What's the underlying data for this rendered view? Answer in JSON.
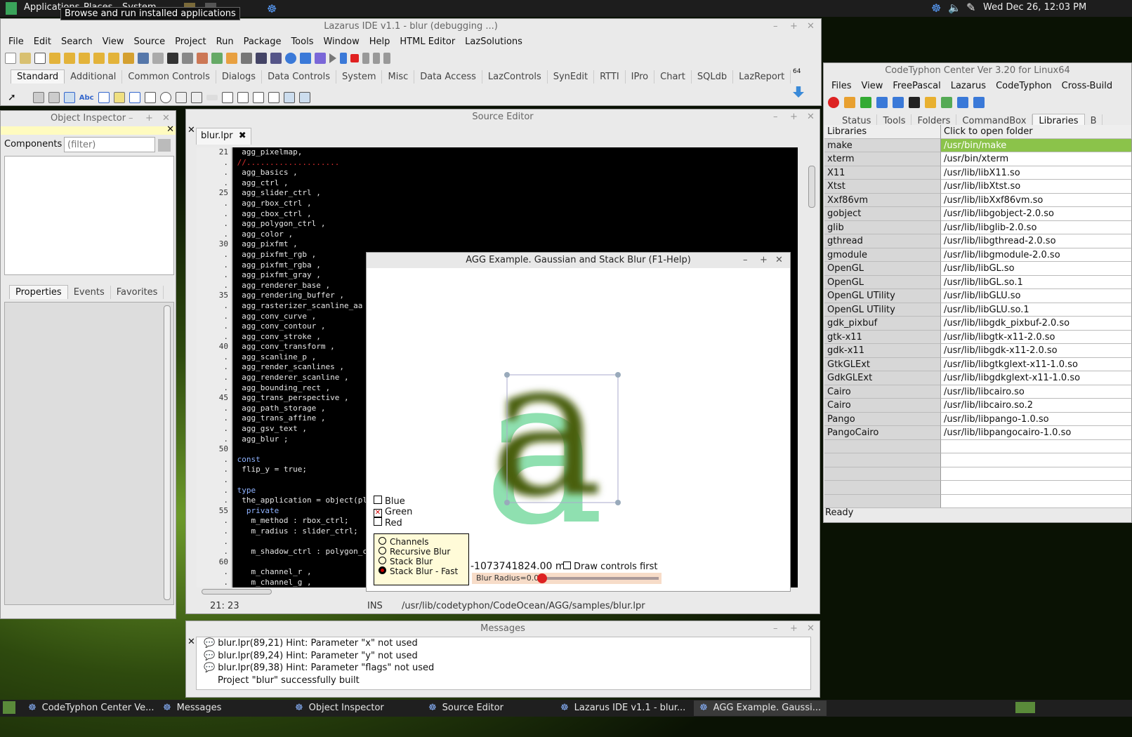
{
  "top_panel": {
    "apps_label": "Applications",
    "places_label": "Places",
    "system_label": "System",
    "clock": "Wed Dec 26, 12:03 PM"
  },
  "tooltip": "Browse and run installed applications",
  "ide": {
    "title": "Lazarus IDE v1.1 - blur (debugging ...)",
    "menu": [
      "File",
      "Edit",
      "Search",
      "View",
      "Source",
      "Project",
      "Run",
      "Package",
      "Tools",
      "Window",
      "Help",
      "HTML Editor",
      "LazSolutions"
    ],
    "palette_tabs": [
      "Standard",
      "Additional",
      "Common Controls",
      "Dialogs",
      "Data Controls",
      "System",
      "Misc",
      "Data Access",
      "LazControls",
      "SynEdit",
      "RTTI",
      "IPro",
      "Chart",
      "SQLdb",
      "LazReport"
    ],
    "arch_badge": "64"
  },
  "object_inspector": {
    "title": "Object Inspector",
    "components_label": "Components",
    "filter_placeholder": "(filter)",
    "tabs": [
      "Properties",
      "Events",
      "Favorites"
    ]
  },
  "source_editor": {
    "title": "Source Editor",
    "tab": "blur.lpr",
    "status": {
      "pos": "21: 23",
      "mode": "INS",
      "path": "/usr/lib/codetyphon/CodeOcean/AGG/samples/blur.lpr"
    },
    "gutter": [
      "21",
      ".",
      ".",
      ".",
      "25",
      ".",
      ".",
      ".",
      ".",
      "30",
      ".",
      ".",
      ".",
      ".",
      "35",
      ".",
      ".",
      ".",
      ".",
      "40",
      ".",
      ".",
      ".",
      ".",
      "45",
      ".",
      ".",
      ".",
      ".",
      "50",
      ".",
      ".",
      ".",
      ".",
      ".",
      "55",
      ".",
      ".",
      ".",
      ".",
      "60",
      ".",
      ".",
      "."
    ],
    "lines": [
      {
        "t": "  agg_pixelmap,",
        "c": "#e6e6e6"
      },
      {
        "t": " //....................",
        "c": "#e03030"
      },
      {
        "t": "  agg_basics ,",
        "c": "#e6e6e6"
      },
      {
        "t": "  agg_ctrl ,",
        "c": "#e6e6e6"
      },
      {
        "t": "  agg_slider_ctrl ,",
        "c": "#e6e6e6"
      },
      {
        "t": "  agg_rbox_ctrl ,",
        "c": "#e6e6e6"
      },
      {
        "t": "  agg_cbox_ctrl ,",
        "c": "#e6e6e6"
      },
      {
        "t": "  agg_polygon_ctrl ,",
        "c": "#e6e6e6"
      },
      {
        "t": "  agg_color ,",
        "c": "#e6e6e6"
      },
      {
        "t": "  agg_pixfmt ,",
        "c": "#e6e6e6"
      },
      {
        "t": "  agg_pixfmt_rgb ,",
        "c": "#e6e6e6"
      },
      {
        "t": "  agg_pixfmt_rgba ,",
        "c": "#e6e6e6"
      },
      {
        "t": "  agg_pixfmt_gray ,",
        "c": "#e6e6e6"
      },
      {
        "t": "  agg_renderer_base ,",
        "c": "#e6e6e6"
      },
      {
        "t": "  agg_rendering_buffer ,",
        "c": "#e6e6e6"
      },
      {
        "t": "  agg_rasterizer_scanline_aa",
        "c": "#e6e6e6"
      },
      {
        "t": "  agg_conv_curve ,",
        "c": "#e6e6e6"
      },
      {
        "t": "  agg_conv_contour ,",
        "c": "#e6e6e6"
      },
      {
        "t": "  agg_conv_stroke ,",
        "c": "#e6e6e6"
      },
      {
        "t": "  agg_conv_transform ,",
        "c": "#e6e6e6"
      },
      {
        "t": "  agg_scanline_p ,",
        "c": "#e6e6e6"
      },
      {
        "t": "  agg_render_scanlines ,",
        "c": "#e6e6e6"
      },
      {
        "t": "  agg_renderer_scanline ,",
        "c": "#e6e6e6"
      },
      {
        "t": "  agg_bounding_rect ,",
        "c": "#e6e6e6"
      },
      {
        "t": "  agg_trans_perspective ,",
        "c": "#e6e6e6"
      },
      {
        "t": "  agg_path_storage ,",
        "c": "#e6e6e6"
      },
      {
        "t": "  agg_trans_affine ,",
        "c": "#e6e6e6"
      },
      {
        "t": "  agg_gsv_text ,",
        "c": "#e6e6e6"
      },
      {
        "t": "  agg_blur ;",
        "c": "#e6e6e6"
      },
      {
        "t": "",
        "c": "#e6e6e6"
      },
      {
        "t": " const",
        "c": "#8fb3ff"
      },
      {
        "t": "  flip_y = true;",
        "c": "#e6e6e6"
      },
      {
        "t": "",
        "c": "#e6e6e6"
      },
      {
        "t": " type",
        "c": "#8fb3ff"
      },
      {
        "t": "  the_application = object(pl",
        "c": "#e6e6e6"
      },
      {
        "t": "   private",
        "c": "#8fb3ff"
      },
      {
        "t": "    m_method : rbox_ctrl;",
        "c": "#e6e6e6"
      },
      {
        "t": "    m_radius : slider_ctrl;",
        "c": "#e6e6e6"
      },
      {
        "t": "",
        "c": "#e6e6e6"
      },
      {
        "t": "    m_shadow_ctrl : polygon_c",
        "c": "#e6e6e6"
      },
      {
        "t": "",
        "c": "#e6e6e6"
      },
      {
        "t": "    m_channel_r ,",
        "c": "#e6e6e6"
      },
      {
        "t": "    m_channel_g ,",
        "c": "#e6e6e6"
      }
    ]
  },
  "agg_window": {
    "title": "AGG Example. Gaussian and Stack Blur (F1-Help)",
    "glyph": "a",
    "checkboxes": [
      {
        "label": "Blue",
        "checked": false
      },
      {
        "label": "Green",
        "checked": true
      },
      {
        "label": "Red",
        "checked": false
      }
    ],
    "radios": [
      {
        "label": "Channels",
        "selected": false
      },
      {
        "label": "Recursive Blur",
        "selected": false
      },
      {
        "label": "Stack Blur",
        "selected": false
      },
      {
        "label": "Stack Blur - Fast",
        "selected": true
      }
    ],
    "readout": "-1073741824.00 ms",
    "draw_controls_label": "Draw controls first",
    "slider_label": "Blur Radius=0.00",
    "slider_fraction": 0.0
  },
  "codetyphon": {
    "title": "CodeTyphon Center Ver 3.20 for Linux64",
    "menu": [
      "Files",
      "View",
      "FreePascal",
      "Lazarus",
      "CodeTyphon",
      "Cross-Build"
    ],
    "tabs": [
      "Status",
      "Tools",
      "Folders",
      "CommandBox",
      "Libraries",
      "B"
    ],
    "col_headers": [
      "Libraries",
      "Click to open folder"
    ],
    "rows": [
      [
        "make",
        "/usr/bin/make"
      ],
      [
        "xterm",
        "/usr/bin/xterm"
      ],
      [
        "X11",
        "/usr/lib/libX11.so"
      ],
      [
        "Xtst",
        "/usr/lib/libXtst.so"
      ],
      [
        "Xxf86vm",
        "/usr/lib/libXxf86vm.so"
      ],
      [
        "gobject",
        "/usr/lib/libgobject-2.0.so"
      ],
      [
        "glib",
        "/usr/lib/libglib-2.0.so"
      ],
      [
        "gthread",
        "/usr/lib/libgthread-2.0.so"
      ],
      [
        "gmodule",
        "/usr/lib/libgmodule-2.0.so"
      ],
      [
        "OpenGL",
        "/usr/lib/libGL.so"
      ],
      [
        "OpenGL",
        "/usr/lib/libGL.so.1"
      ],
      [
        "OpenGL UTility",
        "/usr/lib/libGLU.so"
      ],
      [
        "OpenGL UTility",
        "/usr/lib/libGLU.so.1"
      ],
      [
        "gdk_pixbuf",
        "/usr/lib/libgdk_pixbuf-2.0.so"
      ],
      [
        "gtk-x11",
        "/usr/lib/libgtk-x11-2.0.so"
      ],
      [
        "gdk-x11",
        "/usr/lib/libgdk-x11-2.0.so"
      ],
      [
        "GtkGLExt",
        "/usr/lib/libgtkglext-x11-1.0.so"
      ],
      [
        "GdkGLExt",
        "/usr/lib/libgdkglext-x11-1.0.so"
      ],
      [
        "Cairo",
        "/usr/lib/libcairo.so"
      ],
      [
        "Cairo",
        "/usr/lib/libcairo.so.2"
      ],
      [
        "Pango",
        "/usr/lib/libpango-1.0.so"
      ],
      [
        "PangoCairo",
        "/usr/lib/libpangocairo-1.0.so"
      ],
      [
        "",
        ""
      ],
      [
        "",
        ""
      ],
      [
        "",
        ""
      ],
      [
        "",
        ""
      ],
      [
        "",
        ""
      ]
    ],
    "status": "Ready"
  },
  "messages": {
    "title": "Messages",
    "items": [
      {
        "text": "blur.lpr(89,21) Hint: Parameter \"x\" not used",
        "hint": true
      },
      {
        "text": "blur.lpr(89,24) Hint: Parameter \"y\" not used",
        "hint": true
      },
      {
        "text": "blur.lpr(89,38) Hint: Parameter \"flags\" not used",
        "hint": true
      },
      {
        "text": "Project \"blur\" successfully built",
        "hint": false
      }
    ]
  },
  "taskbar": [
    "CodeTyphon Center Ve...",
    "Messages",
    "Object Inspector",
    "Source Editor",
    "Lazarus IDE v1.1 - blur...",
    "AGG Example. Gaussi..."
  ]
}
